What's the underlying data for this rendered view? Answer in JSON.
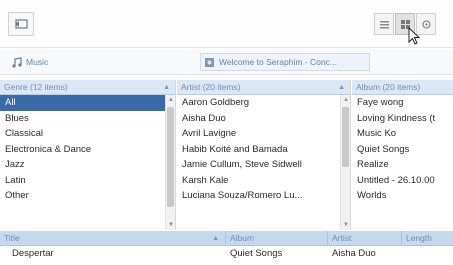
{
  "toolbar": {
    "icons": [
      "back-icon",
      "list-view-icon",
      "grid-view-icon",
      "more-icon"
    ]
  },
  "breadcrumb": {
    "music_label": "Music",
    "album_label": "Welcome to Seraphim - Conc..."
  },
  "browser": {
    "genre": {
      "header": "Genre (12 items)",
      "items": [
        "All",
        "Blues",
        "Classical",
        "Electronica & Dance",
        "Jazz",
        "Latin",
        "Other"
      ],
      "selected_index": 0
    },
    "artist": {
      "header": "Artist (20 items)",
      "items": [
        "Aaron Goldberg",
        "Aisha Duo",
        "Avril Lavigne",
        "Habib Koité and Bamada",
        "Jamie Cullum, Steve Sidwell",
        "Karsh Kale",
        "Luciana Souza/Romero Lu..."
      ]
    },
    "album": {
      "header": "Album (20 items)",
      "items": [
        "Faye wong",
        "Loving Kindness (t",
        "Music Ko",
        "Quiet Songs",
        "Realize",
        "Untitled - 26.10.00",
        "Worlds"
      ]
    }
  },
  "tracks": {
    "headers": {
      "title": "Title",
      "album": "Album",
      "artist": "Artist",
      "length": "Length"
    },
    "rows": [
      {
        "title": "Despertar",
        "album": "Quiet Songs",
        "artist": "Aisha Duo",
        "length": ""
      }
    ]
  }
}
